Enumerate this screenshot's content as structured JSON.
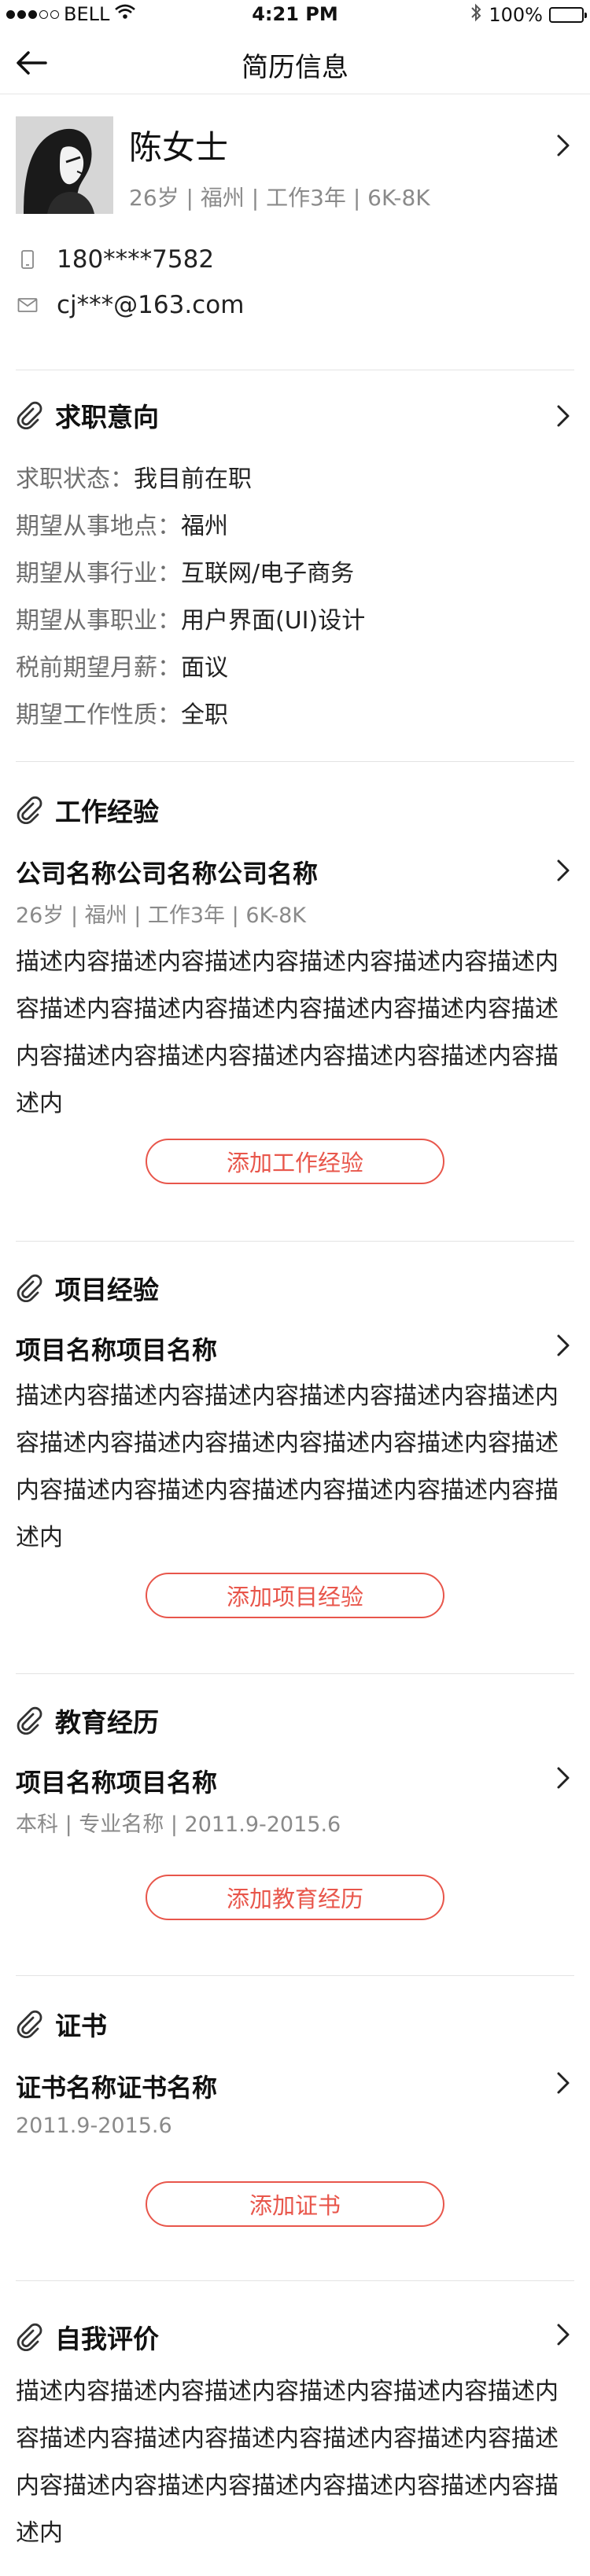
{
  "status_bar": {
    "carrier": "BELL",
    "time": "4:21 PM",
    "battery": "100%"
  },
  "nav": {
    "title": "简历信息"
  },
  "profile": {
    "name": "陈女士",
    "meta": "26岁  |  福州  |  工作3年 | 6K-8K",
    "phone": "180****7582",
    "email": "cj***@163.com"
  },
  "intention": {
    "title": "求职意向",
    "rows": [
      {
        "key": "求职状态：",
        "value": "我目前在职"
      },
      {
        "key": "期望从事地点：",
        "value": "福州"
      },
      {
        "key": "期望从事行业：",
        "value": "互联网/电子商务"
      },
      {
        "key": "期望从事职业：",
        "value": "用户界面(UI)设计"
      },
      {
        "key": "税前期望月薪：",
        "value": "面议"
      },
      {
        "key": "期望工作性质：",
        "value": "全职"
      }
    ]
  },
  "work": {
    "title": "工作经验",
    "item_title": "公司名称公司名称公司名称",
    "item_meta": "26岁  |  福州  |  工作3年 | 6K-8K",
    "desc": "描述内容描述内容描述内容描述内容描述内容描述内容描述内容描述内容描述内容描述内容描述内容描述内容描述内容描述内容描述内容描述内容描述内容描述内",
    "button": "添加工作经验"
  },
  "project": {
    "title": "项目经验",
    "item_title": "项目名称项目名称",
    "desc": "描述内容描述内容描述内容描述内容描述内容描述内容描述内容描述内容描述内容描述内容描述内容描述内容描述内容描述内容描述内容描述内容描述内容描述内",
    "button": "添加项目经验"
  },
  "education": {
    "title": "教育经历",
    "item_title": "项目名称项目名称",
    "item_meta": "本科  |  专业名称  | 2011.9-2015.6",
    "button": "添加教育经历"
  },
  "certificate": {
    "title": "证书",
    "item_title": "证书名称证书名称",
    "item_meta": "2011.9-2015.6",
    "button": "添加证书"
  },
  "self_eval": {
    "title": "自我评价",
    "desc": "描述内容描述内容描述内容描述内容描述内容描述内容描述内容描述内容描述内容描述内容描述内容描述内容描述内容描述内容描述内容描述内容描述内容描述内"
  },
  "icons": {
    "back": "back-arrow-icon",
    "chevron": "chevron-right-icon",
    "section": "paperclip-icon",
    "phone": "phone-icon",
    "email": "mail-icon"
  },
  "colors": {
    "accent": "#e8564b",
    "text": "#222222",
    "muted": "#8a8a8a",
    "divider": "#e3e3e3"
  }
}
